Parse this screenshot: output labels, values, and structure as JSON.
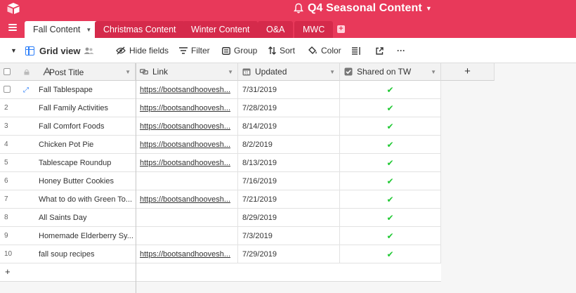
{
  "app": {
    "base_title": "Q4 Seasonal Content",
    "accent_color": "#e8395a",
    "logo_icon": "airtable-logo",
    "notify_icon": "bell-icon"
  },
  "tabs": [
    {
      "label": "Fall Content",
      "active": true
    },
    {
      "label": "Christmas Content",
      "active": false
    },
    {
      "label": "Winter Content",
      "active": false
    },
    {
      "label": "O&A",
      "active": false
    },
    {
      "label": "MWC",
      "active": false
    }
  ],
  "toolbar": {
    "view_name": "Grid view",
    "hide_fields": "Hide fields",
    "filter": "Filter",
    "group": "Group",
    "sort": "Sort",
    "color": "Color",
    "more": "···"
  },
  "table": {
    "columns": [
      {
        "name": "Post Title",
        "icon": "text-field-icon"
      },
      {
        "name": "Link",
        "icon": "link-field-icon"
      },
      {
        "name": "Updated",
        "icon": "date-field-icon"
      },
      {
        "name": "Shared on TW",
        "icon": "checkbox-field-icon"
      }
    ],
    "add_column": "+",
    "add_row": "+",
    "rows": [
      {
        "num": "1",
        "title": "Fall Tablespape",
        "link": "https://bootsandhoovesh...",
        "updated": "7/31/2019",
        "shared": true
      },
      {
        "num": "2",
        "title": "Fall Family Activities",
        "link": "https://bootsandhoovesh...",
        "updated": "7/28/2019",
        "shared": true
      },
      {
        "num": "3",
        "title": "Fall Comfort Foods",
        "link": "https://bootsandhoovesh...",
        "updated": "8/14/2019",
        "shared": true
      },
      {
        "num": "4",
        "title": "Chicken Pot Pie",
        "link": "https://bootsandhoovesh...",
        "updated": "8/2/2019",
        "shared": true
      },
      {
        "num": "5",
        "title": "Tablescape Roundup",
        "link": "https://bootsandhoovesh...",
        "updated": "8/13/2019",
        "shared": true
      },
      {
        "num": "6",
        "title": "Honey Butter Cookies",
        "link": "",
        "updated": "7/16/2019",
        "shared": true
      },
      {
        "num": "7",
        "title": "What to do with Green To...",
        "link": "https://bootsandhoovesh...",
        "updated": "7/21/2019",
        "shared": true
      },
      {
        "num": "8",
        "title": "All Saints Day",
        "link": "",
        "updated": "8/29/2019",
        "shared": true
      },
      {
        "num": "9",
        "title": "Homemade Elderberry Sy...",
        "link": "",
        "updated": "7/3/2019",
        "shared": true
      },
      {
        "num": "10",
        "title": "fall soup recipes",
        "link": "https://bootsandhoovesh...",
        "updated": "7/29/2019",
        "shared": true
      }
    ]
  }
}
